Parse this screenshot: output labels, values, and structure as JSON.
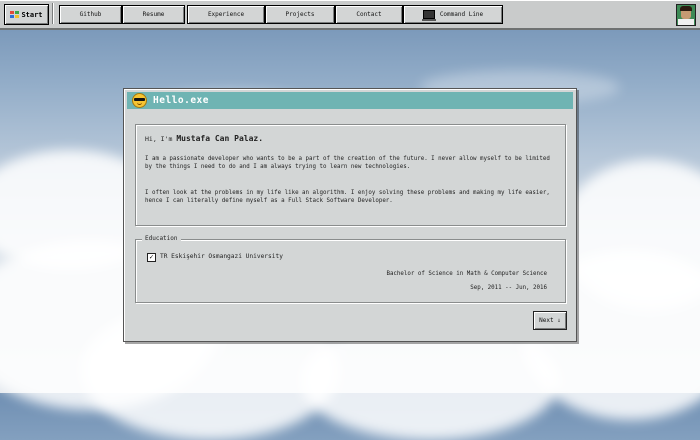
{
  "taskbar": {
    "start_label": "Start",
    "nav": [
      "Github",
      "Resume",
      "Experience",
      "Projects",
      "Contact"
    ],
    "command_line_label": "Command Line"
  },
  "window": {
    "title": "Hello.exe",
    "greeting_prefix": "Hi, I'm",
    "name": "Mustafa Can Palaz.",
    "paragraph1": "I am a passionate developer who wants to be a part of the creation of the future. I never allow myself to be limited by the things I need to do and I am always trying to learn new technologies.",
    "paragraph2": "I often look at the problems in my life like an algorithm. I enjoy solving these problems and making my life easier, hence I can literally define myself as a Full Stack Software Developer.",
    "education": {
      "legend": "Education",
      "checkbox_mark": "✓",
      "university": "TR Eskişehir Osmangazi University",
      "degree": "Bachelor of Science in Math & Computer Science",
      "dates": "Sep, 2011 -- Jun, 2016"
    },
    "next_label": "Next ⇓"
  },
  "colors": {
    "titlebar": "#6fb4b3",
    "window_bg": "#d3d6d6",
    "taskbar_bg": "#c9cbcb"
  }
}
